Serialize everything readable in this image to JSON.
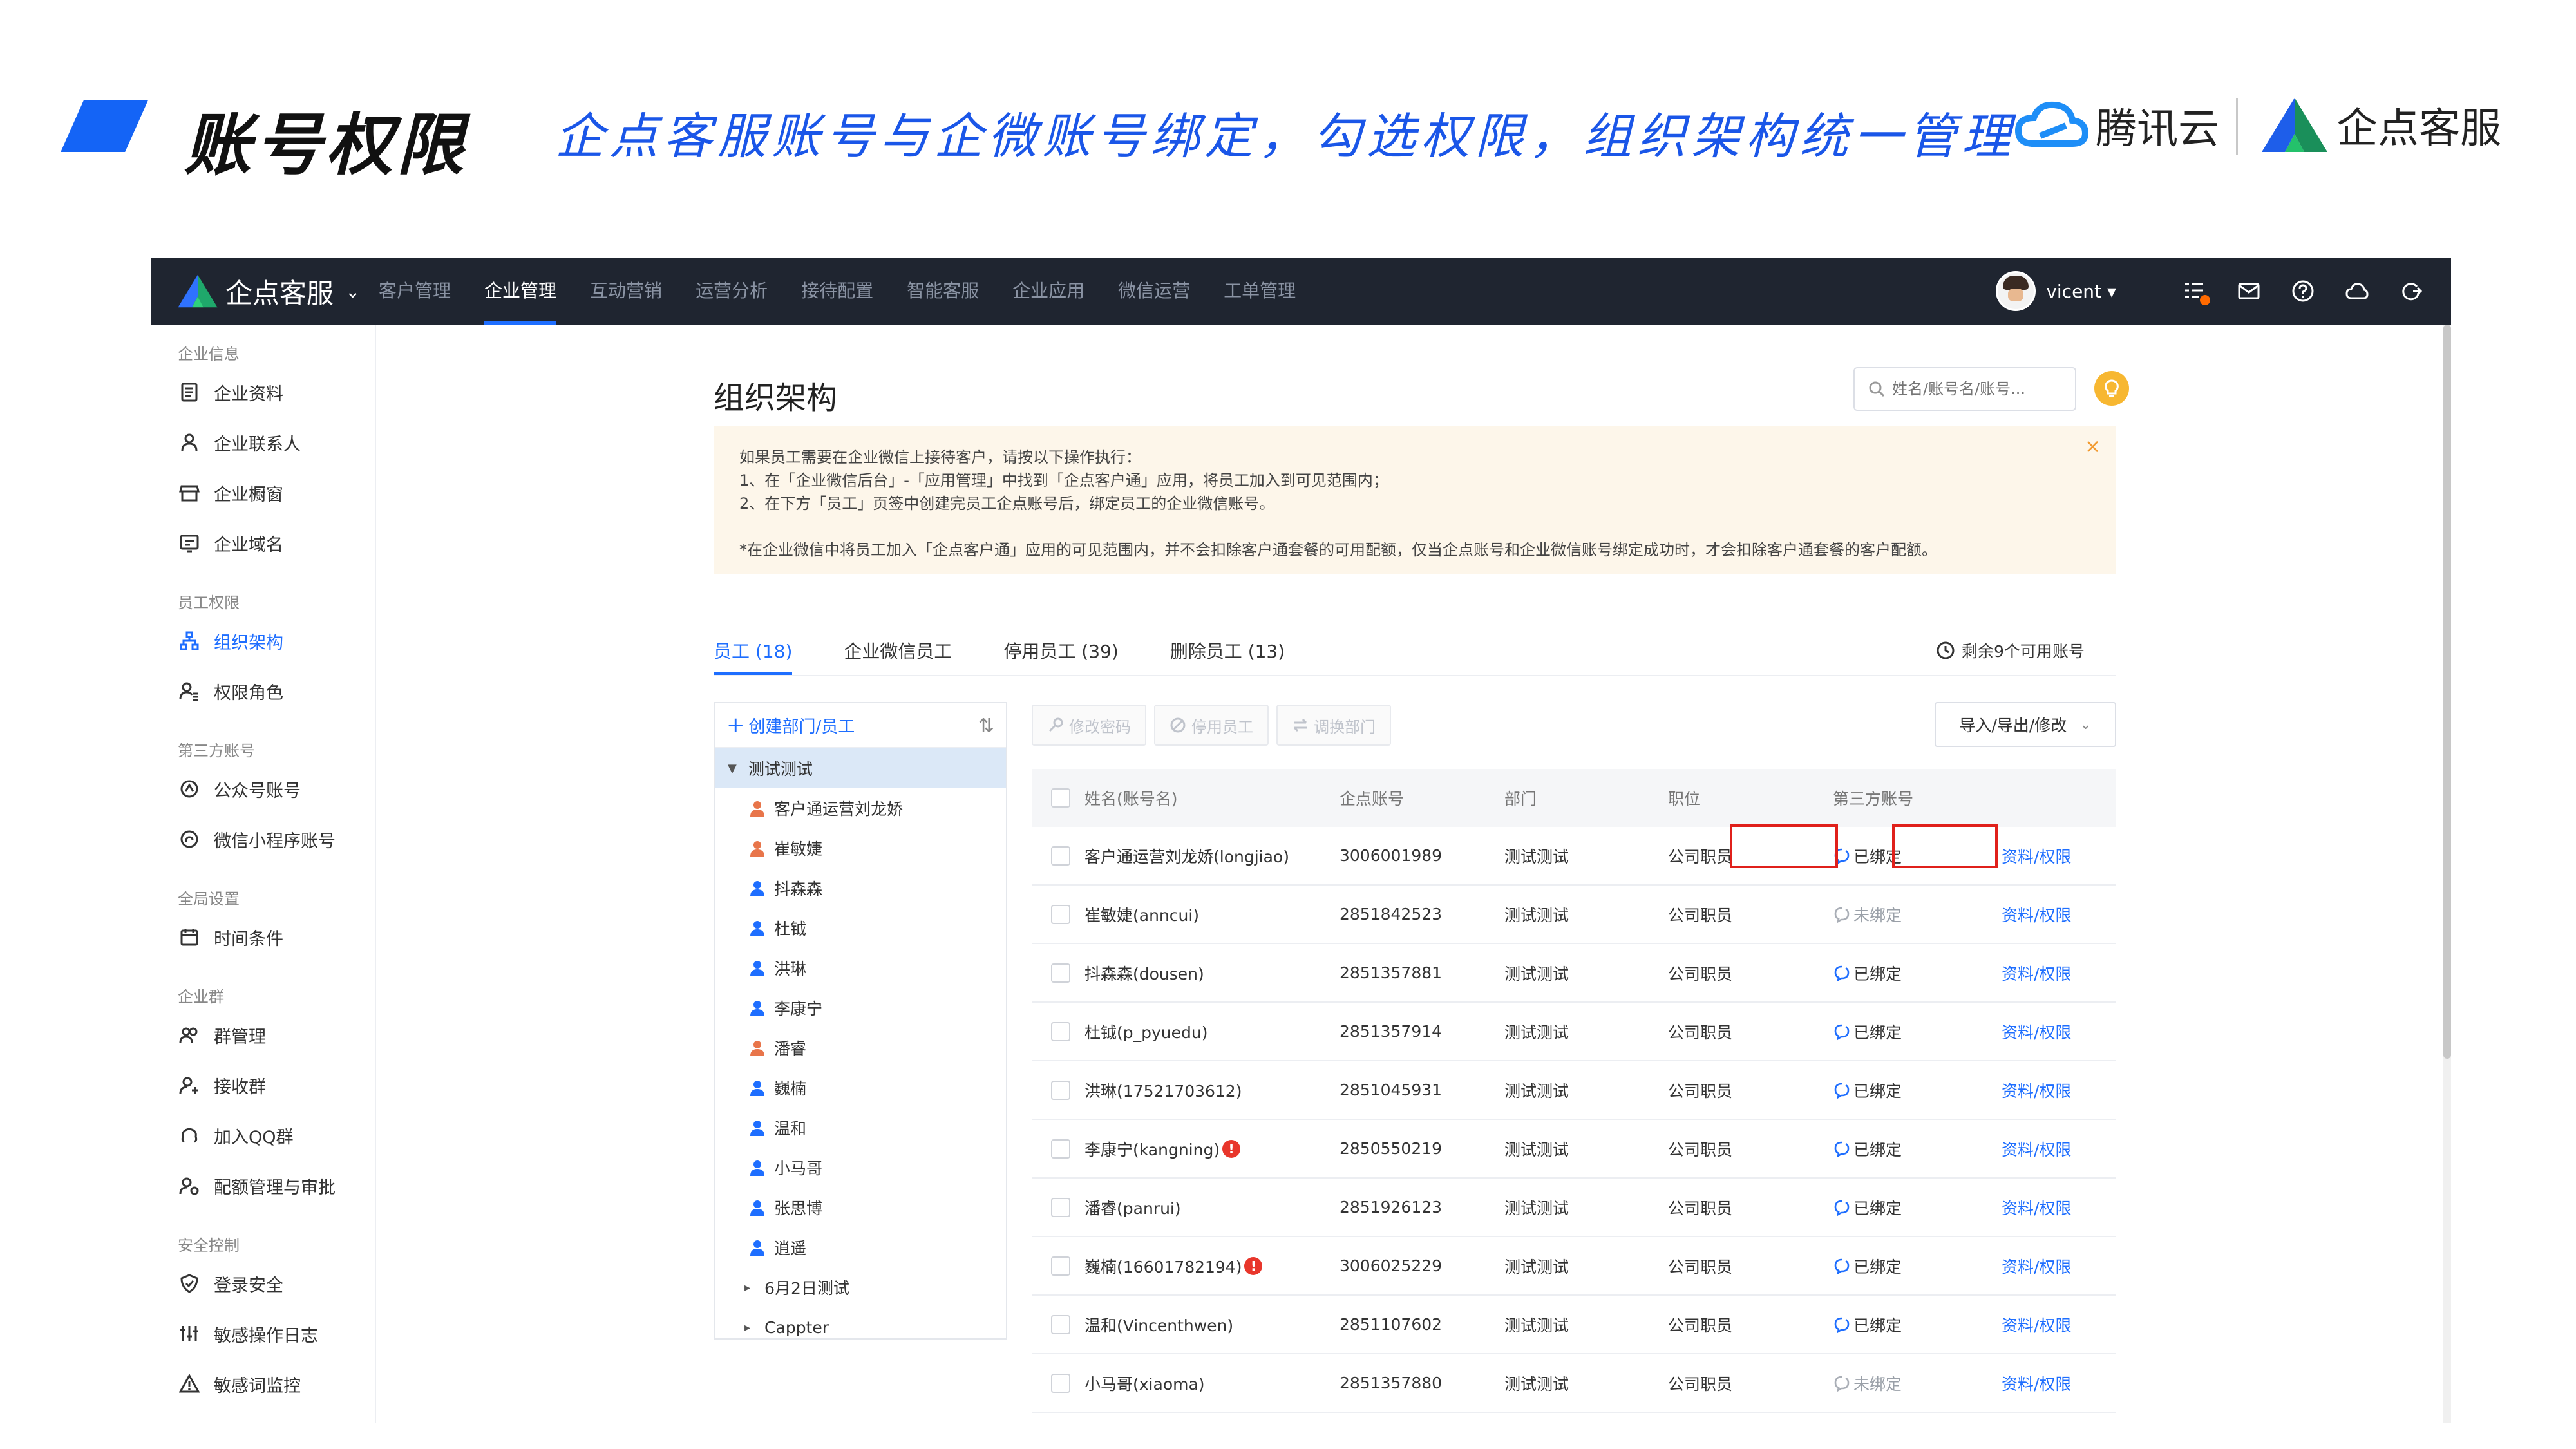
{
  "slide": {
    "title": "账号权限",
    "subtitle": "企点客服账号与企微账号绑定，勾选权限，组织架构统一管理",
    "brand_tencent": "腾讯云",
    "brand_qidian": "企点客服"
  },
  "nav": {
    "logo": "企点客服",
    "menu": [
      "客户管理",
      "企业管理",
      "互动营销",
      "运营分析",
      "接待配置",
      "智能客服",
      "企业应用",
      "微信运营",
      "工单管理"
    ],
    "active_index": 1,
    "user": "vicent",
    "user_caret": "▾",
    "icons": [
      "task-list-icon",
      "mail-icon",
      "help-icon",
      "cloud-icon",
      "logout-icon"
    ]
  },
  "sidebar": {
    "groups": [
      {
        "title": "企业信息",
        "items": [
          {
            "label": "企业资料",
            "icon": "document-icon"
          },
          {
            "label": "企业联系人",
            "icon": "contact-icon"
          },
          {
            "label": "企业橱窗",
            "icon": "store-icon"
          },
          {
            "label": "企业域名",
            "icon": "domain-icon"
          }
        ]
      },
      {
        "title": "员工权限",
        "items": [
          {
            "label": "组织架构",
            "icon": "org-chart-icon",
            "active": true
          },
          {
            "label": "权限角色",
            "icon": "role-icon"
          }
        ]
      },
      {
        "title": "第三方账号",
        "items": [
          {
            "label": "公众号账号",
            "icon": "official-account-icon"
          },
          {
            "label": "微信小程序账号",
            "icon": "mini-program-icon"
          }
        ]
      },
      {
        "title": "全局设置",
        "items": [
          {
            "label": "时间条件",
            "icon": "calendar-icon"
          }
        ]
      },
      {
        "title": "企业群",
        "items": [
          {
            "label": "群管理",
            "icon": "group-icon"
          },
          {
            "label": "接收群",
            "icon": "receive-group-icon"
          },
          {
            "label": "加入QQ群",
            "icon": "qq-group-icon"
          },
          {
            "label": "配额管理与审批",
            "icon": "quota-icon"
          }
        ]
      },
      {
        "title": "安全控制",
        "items": [
          {
            "label": "登录安全",
            "icon": "shield-icon"
          },
          {
            "label": "敏感操作日志",
            "icon": "sliders-icon"
          },
          {
            "label": "敏感词监控",
            "icon": "warning-icon"
          }
        ]
      }
    ]
  },
  "main": {
    "title": "组织架构",
    "search_placeholder": "姓名/账号名/账号...",
    "notice": {
      "line1": "如果员工需要在企业微信上接待客户，请按以下操作执行：",
      "line2": "1、在「企业微信后台」-「应用管理」中找到「企点客户通」应用，将员工加入到可见范围内；",
      "line3": "2、在下方「员工」页签中创建完员工企点账号后，绑定员工的企业微信账号。",
      "line4": "*在企业微信中将员工加入「企点客户通」应用的可见范围内，并不会扣除客户通套餐的可用配额，仅当企点账号和企业微信账号绑定成功时，才会扣除客户通套餐的客户配额。",
      "close": "×"
    },
    "tabs": [
      "员工 (18)",
      "企业微信员工",
      "停用员工 (39)",
      "删除员工 (13)"
    ],
    "active_tab": 0,
    "remaining": "剩余9个可用账号",
    "tree": {
      "create_label": "创建部门/员工",
      "sort_icon": "⇅",
      "root": "测试测试",
      "members": [
        {
          "name": "客户通运营刘龙娇",
          "color": "#e8754a"
        },
        {
          "name": "崔敏婕",
          "color": "#e8754a"
        },
        {
          "name": "抖森森",
          "color": "#1e6eff"
        },
        {
          "name": "杜钺",
          "color": "#1e6eff"
        },
        {
          "name": "洪琳",
          "color": "#1e6eff"
        },
        {
          "name": "李康宁",
          "color": "#1e6eff"
        },
        {
          "name": "潘睿",
          "color": "#e8754a"
        },
        {
          "name": "巍楠",
          "color": "#1e6eff"
        },
        {
          "name": "温和",
          "color": "#1e6eff"
        },
        {
          "name": "小马哥",
          "color": "#1e6eff"
        },
        {
          "name": "张思博",
          "color": "#1e6eff"
        },
        {
          "name": "逍遥",
          "color": "#1e6eff"
        }
      ],
      "depts": [
        "6月2日测试",
        "Cappter"
      ]
    },
    "toolbar": [
      "修改密码",
      "停用员工",
      "调换部门"
    ],
    "import_label": "导入/导出/修改",
    "table": {
      "headers": [
        "姓名(账号名)",
        "企点账号",
        "部门",
        "职位",
        "第三方账号"
      ],
      "rows": [
        {
          "name": "客户通运营刘龙娇(longjiao)",
          "account": "3006001989",
          "dept": "测试测试",
          "position": "公司职员",
          "third": "已绑定",
          "bound": true,
          "op": "资料/权限",
          "warn": false
        },
        {
          "name": "崔敏婕(anncui)",
          "account": "2851842523",
          "dept": "测试测试",
          "position": "公司职员",
          "third": "未绑定",
          "bound": false,
          "op": "资料/权限",
          "warn": false
        },
        {
          "name": "抖森森(dousen)",
          "account": "2851357881",
          "dept": "测试测试",
          "position": "公司职员",
          "third": "已绑定",
          "bound": true,
          "op": "资料/权限",
          "warn": false
        },
        {
          "name": "杜钺(p_pyuedu)",
          "account": "2851357914",
          "dept": "测试测试",
          "position": "公司职员",
          "third": "已绑定",
          "bound": true,
          "op": "资料/权限",
          "warn": false
        },
        {
          "name": "洪琳(17521703612)",
          "account": "2851045931",
          "dept": "测试测试",
          "position": "公司职员",
          "third": "已绑定",
          "bound": true,
          "op": "资料/权限",
          "warn": false
        },
        {
          "name": "李康宁(kangning)",
          "account": "2850550219",
          "dept": "测试测试",
          "position": "公司职员",
          "third": "已绑定",
          "bound": true,
          "op": "资料/权限",
          "warn": true
        },
        {
          "name": "潘睿(panrui)",
          "account": "2851926123",
          "dept": "测试测试",
          "position": "公司职员",
          "third": "已绑定",
          "bound": true,
          "op": "资料/权限",
          "warn": false
        },
        {
          "name": "巍楠(16601782194)",
          "account": "3006025229",
          "dept": "测试测试",
          "position": "公司职员",
          "third": "已绑定",
          "bound": true,
          "op": "资料/权限",
          "warn": true
        },
        {
          "name": "温和(Vincenthwen)",
          "account": "2851107602",
          "dept": "测试测试",
          "position": "公司职员",
          "third": "已绑定",
          "bound": true,
          "op": "资料/权限",
          "warn": false
        },
        {
          "name": "小马哥(xiaoma)",
          "account": "2851357880",
          "dept": "测试测试",
          "position": "公司职员",
          "third": "未绑定",
          "bound": false,
          "op": "资料/权限",
          "warn": false
        }
      ]
    }
  }
}
